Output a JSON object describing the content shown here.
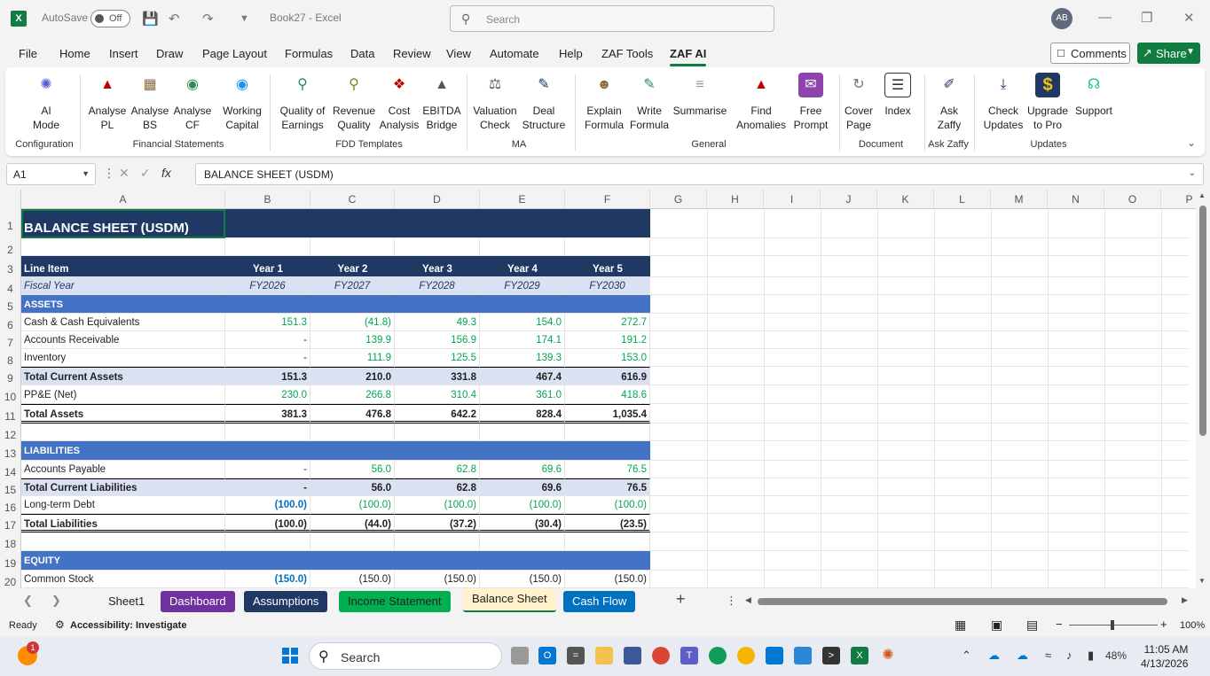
{
  "titlebar": {
    "app_icon": "X",
    "autosave_label": "AutoSave",
    "autosave_state": "Off",
    "doc_title": "Book27  -  Excel",
    "search_placeholder": "Search",
    "avatar_initials": "AB"
  },
  "menu": {
    "tabs": [
      "File",
      "Home",
      "Insert",
      "Draw",
      "Page Layout",
      "Formulas",
      "Data",
      "Review",
      "View",
      "Automate",
      "Help",
      "ZAF Tools",
      "ZAF AI"
    ],
    "comments_label": "Comments",
    "share_label": "Share"
  },
  "ribbon": {
    "buttons": [
      {
        "label1": "AI",
        "label2": "Mode"
      },
      {
        "label1": "Analyse",
        "label2": "PL"
      },
      {
        "label1": "Analyse",
        "label2": "BS"
      },
      {
        "label1": "Analyse",
        "label2": "CF"
      },
      {
        "label1": "Working",
        "label2": "Capital"
      },
      {
        "label1": "Quality of",
        "label2": "Earnings"
      },
      {
        "label1": "Revenue",
        "label2": "Quality"
      },
      {
        "label1": "Cost",
        "label2": "Analysis"
      },
      {
        "label1": "EBITDA",
        "label2": "Bridge"
      },
      {
        "label1": "Valuation",
        "label2": "Check"
      },
      {
        "label1": "Deal",
        "label2": "Structure"
      },
      {
        "label1": "Explain",
        "label2": "Formula"
      },
      {
        "label1": "Write",
        "label2": "Formula"
      },
      {
        "label1": "Summarise",
        "label2": ""
      },
      {
        "label1": "Find",
        "label2": "Anomalies"
      },
      {
        "label1": "Free",
        "label2": "Prompt"
      },
      {
        "label1": "Cover",
        "label2": "Page"
      },
      {
        "label1": "Index",
        "label2": ""
      },
      {
        "label1": "Ask",
        "label2": "Zaffy"
      },
      {
        "label1": "Check",
        "label2": "Updates"
      },
      {
        "label1": "Upgrade",
        "label2": "to Pro"
      },
      {
        "label1": "Support",
        "label2": ""
      }
    ],
    "groups": [
      "Configuration",
      "Financial Statements",
      "FDD Templates",
      "MA",
      "General",
      "Document",
      "Ask Zaffy",
      "Updates"
    ]
  },
  "formula_bar": {
    "name_box": "A1",
    "formula": "BALANCE SHEET (USDM)"
  },
  "columns": [
    "A",
    "B",
    "C",
    "D",
    "E",
    "F",
    "G",
    "H",
    "I",
    "J",
    "K",
    "L",
    "M",
    "N",
    "O",
    "P"
  ],
  "sheet": {
    "title": "BALANCE SHEET (USDM)",
    "header": [
      "Line Item",
      "Year 1",
      "Year 2",
      "Year 3",
      "Year 4",
      "Year 5"
    ],
    "fiscal": [
      "Fiscal Year",
      "FY2026",
      "FY2027",
      "FY2028",
      "FY2029",
      "FY2030"
    ],
    "rows": [
      {
        "r": "5",
        "type": "section",
        "cells": [
          "ASSETS"
        ]
      },
      {
        "r": "6",
        "type": "data",
        "cells": [
          "Cash & Cash Equivalents",
          "151.3",
          "(41.8)",
          "49.3",
          "154.0",
          "272.7"
        ]
      },
      {
        "r": "7",
        "type": "data",
        "cells": [
          "Accounts Receivable",
          "-",
          "139.9",
          "156.9",
          "174.1",
          "191.2"
        ]
      },
      {
        "r": "8",
        "type": "data",
        "cells": [
          "Inventory",
          "-",
          "111.9",
          "125.5",
          "139.3",
          "153.0"
        ]
      },
      {
        "r": "9",
        "type": "total",
        "cells": [
          "Total Current Assets",
          "151.3",
          "210.0",
          "331.8",
          "467.4",
          "616.9"
        ]
      },
      {
        "r": "10",
        "type": "data",
        "cells": [
          "PP&E (Net)",
          "230.0",
          "266.8",
          "310.4",
          "361.0",
          "418.6"
        ]
      },
      {
        "r": "11",
        "type": "grand",
        "cells": [
          "Total Assets",
          "381.3",
          "476.8",
          "642.2",
          "828.4",
          "1,035.4"
        ]
      },
      {
        "r": "12",
        "type": "blank",
        "cells": []
      },
      {
        "r": "13",
        "type": "section",
        "cells": [
          "LIABILITIES"
        ]
      },
      {
        "r": "14",
        "type": "data",
        "cells": [
          "Accounts Payable",
          "-",
          "56.0",
          "62.8",
          "69.6",
          "76.5"
        ]
      },
      {
        "r": "15",
        "type": "total",
        "cells": [
          "Total Current Liabilities",
          "-",
          "56.0",
          "62.8",
          "69.6",
          "76.5"
        ]
      },
      {
        "r": "16",
        "type": "debt",
        "cells": [
          "Long-term Debt",
          "(100.0)",
          "(100.0)",
          "(100.0)",
          "(100.0)",
          "(100.0)"
        ]
      },
      {
        "r": "17",
        "type": "grand",
        "cells": [
          "Total Liabilities",
          "(100.0)",
          "(44.0)",
          "(37.2)",
          "(30.4)",
          "(23.5)"
        ]
      },
      {
        "r": "18",
        "type": "blank",
        "cells": []
      },
      {
        "r": "19",
        "type": "section",
        "cells": [
          "EQUITY"
        ]
      },
      {
        "r": "20",
        "type": "stock",
        "cells": [
          "Common Stock",
          "(150.0)",
          "(150.0)",
          "(150.0)",
          "(150.0)",
          "(150.0)"
        ]
      }
    ]
  },
  "sheet_tabs": [
    {
      "name": "Sheet1",
      "bg": "transparent",
      "fg": "#222222"
    },
    {
      "name": "Dashboard",
      "bg": "#7030a0",
      "fg": "#ffffff"
    },
    {
      "name": "Assumptions",
      "bg": "#1f3864",
      "fg": "#ffffff"
    },
    {
      "name": "Income Statement",
      "bg": "#00b050",
      "fg": "#222222"
    },
    {
      "name": "Balance Sheet",
      "bg": "#fff2cc",
      "fg": "#222222"
    },
    {
      "name": "Cash Flow",
      "bg": "#0070c0",
      "fg": "#ffffff"
    }
  ],
  "status": {
    "ready": "Ready",
    "accessibility": "Accessibility: Investigate",
    "zoom": "100%"
  },
  "taskbar": {
    "search": "Search",
    "battery": "48%",
    "time": "11:05 AM",
    "date": "4/13/2026",
    "badge": "1"
  },
  "colors": {
    "header_navy": "#1f3864",
    "section_blue": "#4472c4",
    "fiscal_bg": "#d9e1f2",
    "input_green": "#00a651",
    "input_blue": "#0070c0",
    "excel_green": "#107c41"
  }
}
